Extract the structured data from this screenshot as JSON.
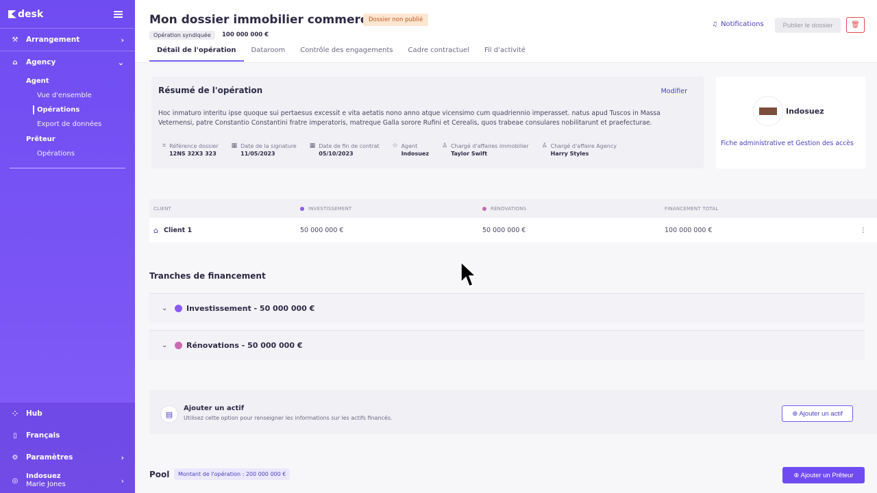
{
  "sidebar": {
    "logo": "desk",
    "nav": {
      "arrangement": "Arrangement",
      "agency": "Agency"
    },
    "agent_head": "Agent",
    "agent_items": [
      "Vue d'ensemble",
      "Opérations",
      "Export de données"
    ],
    "lender_head": "Prêteur",
    "lender_items": [
      "Opérations"
    ],
    "bottom": {
      "hub": "Hub",
      "language": "Français",
      "settings": "Paramètres",
      "org": "Indosuez",
      "user": "Marie Jones"
    }
  },
  "header": {
    "title": "Mon dossier immobilier commercial",
    "status_badge": "Dossier non publié",
    "op_type": "Opération syndiquée",
    "amount": "100 000 000 €",
    "notifications": "Notifications",
    "publish": "Publier le dossier",
    "tabs": [
      "Détail de l'opération",
      "Dataroom",
      "Contrôle des engagements",
      "Cadre contractuel",
      "Fil d'activité"
    ]
  },
  "summary": {
    "title": "Résumé de l'opération",
    "modify": "Modifier",
    "description": "Hoc inmaturo interitu ipse quoque sui pertaesus excessit e vita aetatis nono anno atque vicensimo cum quadriennio imperasset. natus apud Tuscos in Massa Veternensi, patre Constantio Constantini fratre imperatoris, matreque Galla sorore Rufini et Cerealis, quos trabeae consulares nobilitarunt et praefecturae.",
    "meta": [
      {
        "icon": "tag-icon",
        "label": "Référence dossier",
        "value": "12NS 32X3 323"
      },
      {
        "icon": "calendar-icon",
        "label": "Date de la signature",
        "value": "11/05/2023"
      },
      {
        "icon": "calendar-icon",
        "label": "Date de fin de contrat",
        "value": "05/10/2023"
      },
      {
        "icon": "star-icon",
        "label": "Agent",
        "value": "Indosuez"
      },
      {
        "icon": "user-icon",
        "label": "Chargé d'affaires immobilier",
        "value": "Taylor Swift"
      },
      {
        "icon": "user-icon",
        "label": "Chargé d'affaire Agency",
        "value": "Harry Styles"
      }
    ]
  },
  "agent_card": {
    "name": "Indosuez",
    "link": "Fiche administrative et Gestion des accès"
  },
  "client_table": {
    "headers": [
      "CLIENT",
      "INVESTISSEMENT",
      "RÉNOVATIONS",
      "FINANCEMENT TOTAL"
    ],
    "rows": [
      {
        "client": "Client 1",
        "investissement": "50 000 000 €",
        "renovations": "50 000 000 €",
        "total": "100 000 000 €"
      }
    ],
    "colors": {
      "investissement": "#8a5cf0",
      "renovations": "#c86bb0"
    }
  },
  "tranches": {
    "title": "Tranches de financement",
    "items": [
      {
        "label": "Investissement - 50 000 000 €",
        "color": "#8a5cf0"
      },
      {
        "label": "Rénovations - 50 000 000 €",
        "color": "#c86bb0"
      }
    ]
  },
  "asset": {
    "title": "Ajouter un actif",
    "description": "Utilisez cette option pour renseigner les informations sur les actifs financés.",
    "button": "Ajouter un actif"
  },
  "pool": {
    "title": "Pool",
    "chip": "Montant de l'opération : 200 000 000 €",
    "button": "Ajouter un Prêteur"
  }
}
